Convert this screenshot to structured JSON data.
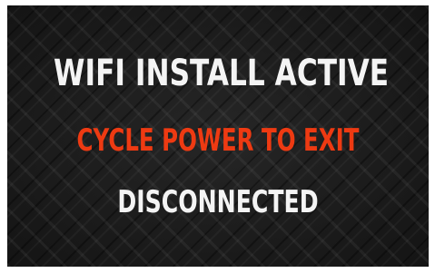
{
  "screen": {
    "title": "WIFI INSTALL ACTIVE",
    "warning": "CYCLE POWER TO EXIT",
    "status": "DISCONNECTED"
  },
  "colors": {
    "title": "#f4f4f4",
    "warning": "#ee3a12",
    "status": "#f4f4f4",
    "background": "#1b1b1b"
  }
}
